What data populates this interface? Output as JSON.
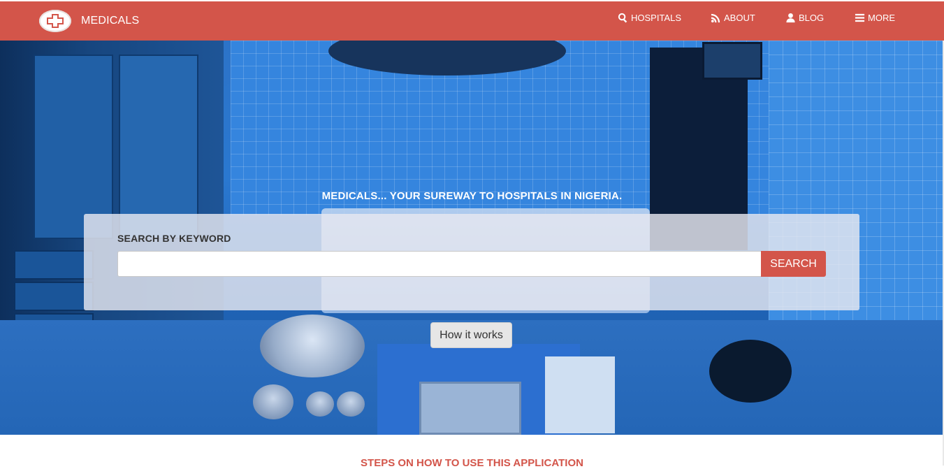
{
  "brand": {
    "name": "MEDICALS",
    "logo_icon": "medical-cross-icon"
  },
  "nav": {
    "items": [
      {
        "label": "HOSPITALS",
        "icon": "search-icon"
      },
      {
        "label": "ABOUT",
        "icon": "rss-icon"
      },
      {
        "label": "BLOG",
        "icon": "user-icon"
      },
      {
        "label": "MORE",
        "icon": "menu-icon"
      }
    ]
  },
  "hero": {
    "tagline": "MEDICALS... YOUR SUREWAY TO HOSPITALS IN NIGERIA.",
    "search": {
      "label": "SEARCH BY KEYWORD",
      "value": "",
      "placeholder": "",
      "button_label": "SEARCH"
    },
    "how_it_works_label": "How it works"
  },
  "steps": {
    "heading": "STEPS ON HOW TO USE THIS APPLICATION"
  },
  "colors": {
    "accent": "#d3554a",
    "white": "#ffffff"
  }
}
